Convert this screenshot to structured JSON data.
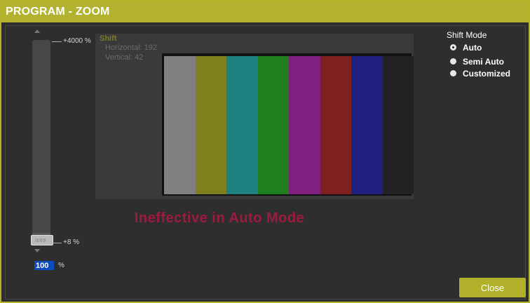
{
  "window": {
    "title": "PROGRAM - ZOOM"
  },
  "zoom": {
    "max_label": "+4000 %",
    "min_label": "+8 %",
    "value": "100",
    "unit": "%",
    "level_fraction": 0.0
  },
  "shift": {
    "title": "Shift",
    "horizontal": "Horizontal: 192",
    "vertical": "Vertical: 42"
  },
  "test_pattern": {
    "colors": [
      "#808080",
      "#7f7f1e",
      "#1f8080",
      "#1f7f1f",
      "#7f1f7f",
      "#7f1f1f",
      "#1f1f7f",
      "#222222"
    ]
  },
  "message": "Ineffective in Auto Mode",
  "shift_mode": {
    "title": "Shift Mode",
    "options": [
      {
        "label": "Auto",
        "checked": true
      },
      {
        "label": "Semi Auto",
        "checked": false
      },
      {
        "label": "Customized",
        "checked": false
      }
    ]
  },
  "buttons": {
    "close": "Close"
  },
  "colors": {
    "accent": "#b2b22e",
    "message": "#9e1a3e",
    "input_bg": "#0b4dbf"
  }
}
